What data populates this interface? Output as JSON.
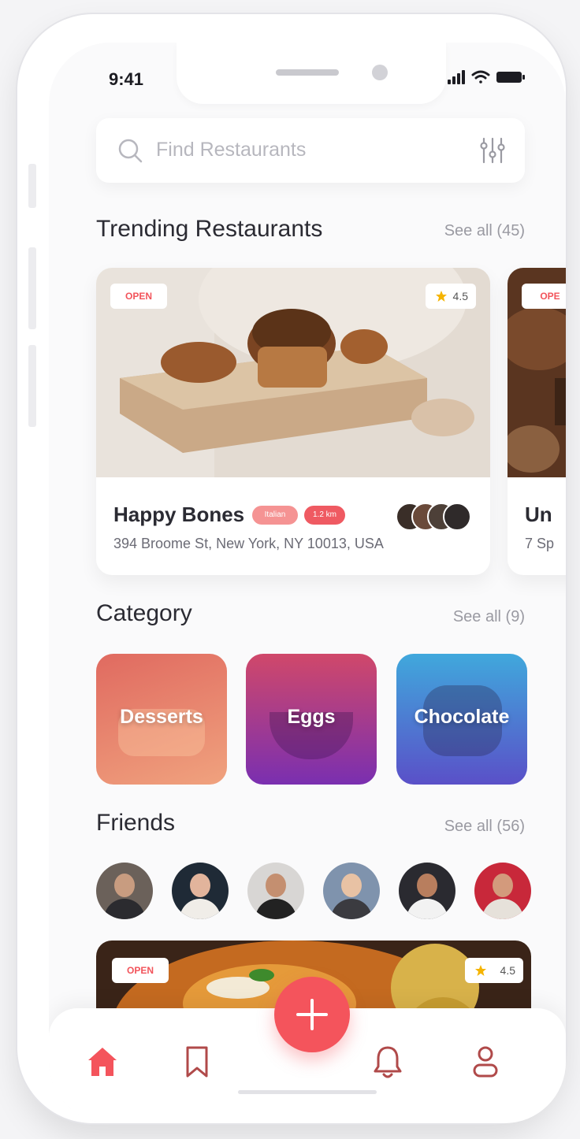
{
  "status_bar": {
    "time": "9:41"
  },
  "search": {
    "placeholder": "Find Restaurants"
  },
  "trending": {
    "title": "Trending Restaurants",
    "see_all": "See all (45)",
    "cards": [
      {
        "status": "OPEN",
        "rating": "4.5",
        "name": "Happy Bones",
        "cuisine_tag": "Italian",
        "distance_tag": "1.2 km",
        "address": "394 Broome St, New York, NY 10013, USA"
      },
      {
        "status": "OPE",
        "name": "Un",
        "address": "7 Sp"
      }
    ]
  },
  "category": {
    "title": "Category",
    "see_all": "See all (9)",
    "items": [
      {
        "label": "Desserts"
      },
      {
        "label": "Eggs"
      },
      {
        "label": "Chocolate"
      }
    ]
  },
  "friends": {
    "title": "Friends",
    "see_all": "See all (56)",
    "count_visible": 6
  },
  "featured": {
    "status": "OPEN",
    "rating": "4.5"
  },
  "tabbar": {
    "items": [
      "home-icon",
      "bookmark-icon",
      "add-icon",
      "bell-icon",
      "user-icon"
    ],
    "active": "home-icon"
  },
  "colors": {
    "accent": "#f4545c",
    "text": "#2b2b33",
    "muted": "#9a9aa2",
    "star": "#f5b400"
  }
}
